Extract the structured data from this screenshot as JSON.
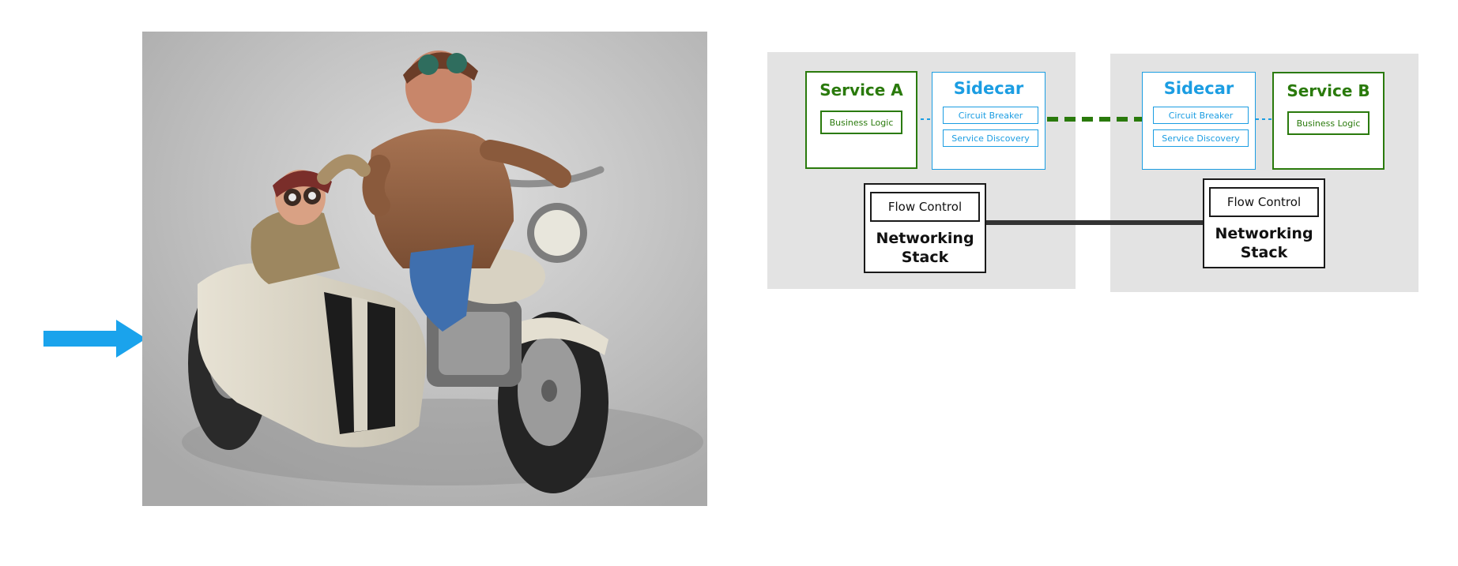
{
  "arrow": {
    "icon": "right-arrow-icon",
    "color": "#1aa3ec"
  },
  "photo": {
    "icon": "sidecar-motorcycle-figurine-image"
  },
  "diagram": {
    "left_node": {
      "service": {
        "title": "Service A",
        "logic": "Business Logic"
      },
      "sidecar": {
        "title": "Sidecar",
        "items": [
          "Circuit Breaker",
          "Service Discovery"
        ]
      },
      "network": {
        "flow": "Flow Control",
        "title": "Networking Stack"
      }
    },
    "right_node": {
      "service": {
        "title": "Service B",
        "logic": "Business Logic"
      },
      "sidecar": {
        "title": "Sidecar",
        "items": [
          "Circuit Breaker",
          "Service Discovery"
        ]
      },
      "network": {
        "flow": "Flow Control",
        "title": "Networking Stack"
      }
    },
    "colors": {
      "service": "#2a7a0c",
      "sidecar": "#1b9de2",
      "network": "#1a1a1a",
      "panel": "#e3e3e3"
    }
  }
}
